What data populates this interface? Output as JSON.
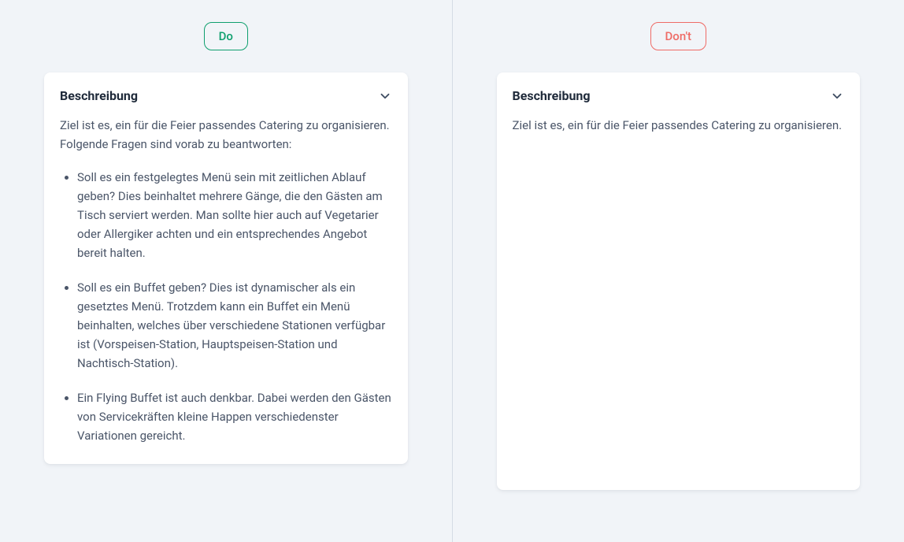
{
  "left": {
    "pill_label": "Do",
    "card_title": "Beschreibung",
    "intro": "Ziel ist es, ein für die Feier passendes Catering zu organisieren. Folgende Fragen sind vorab zu beantworten:",
    "bullets": [
      "Soll es ein festgelegtes Menü sein mit zeitlichen Ablauf geben? Dies beinhaltet mehrere Gänge, die den Gästen am Tisch serviert werden. Man sollte hier auch auf Vegetarier oder Allergiker achten und ein entsprechendes Angebot bereit halten.",
      "Soll es ein Buffet geben? Dies ist dynamischer als ein gesetztes Menü. Trotzdem kann ein Buffet ein Menü beinhalten, welches über verschiedene Stationen verfügbar ist (Vorspeisen-Station, Hauptspeisen-Station und Nachtisch-Station).",
      "Ein Flying Buffet ist auch denkbar. Dabei werden den Gästen von Servicekräften kleine Happen verschiedenster Variationen gereicht."
    ]
  },
  "right": {
    "pill_label": "Don't",
    "card_title": "Beschreibung",
    "intro": "Ziel ist es, ein für die Feier passendes Catering zu organisieren."
  },
  "colors": {
    "do": "#0f9f6e",
    "dont": "#ef6b66",
    "bg": "#f1f4f8"
  }
}
